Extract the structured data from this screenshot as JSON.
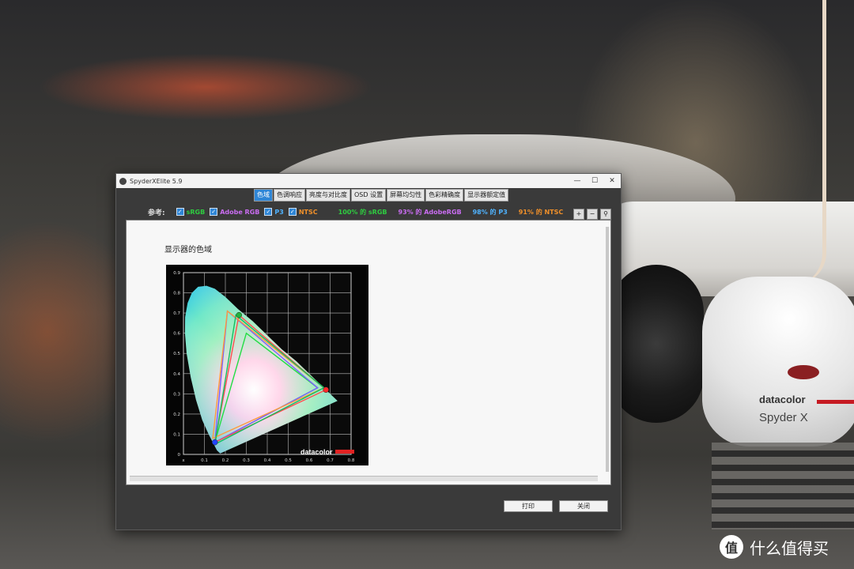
{
  "window": {
    "title": "SpyderXElite 5.9"
  },
  "tabs": [
    "色域",
    "色调响应",
    "亮度与对比度",
    "OSD 设置",
    "屏幕均匀性",
    "色彩精确度",
    "显示器额定值"
  ],
  "reference": {
    "label": "参考:",
    "checkboxes": [
      "sRGB",
      "Adobe RGB",
      "P3",
      "NTSC"
    ],
    "results": [
      "100% 的 sRGB",
      "93% 的 AdobeRGB",
      "98% 的 P3",
      "91% 的 NTSC"
    ]
  },
  "content": {
    "heading": "显示器的色域"
  },
  "buttons": {
    "print": "打印",
    "close": "关闭"
  },
  "device": {
    "brand": "datacolor",
    "model": "Spyder X"
  },
  "watermark": {
    "logo": "值",
    "text": "什么值得买"
  },
  "chart_data": {
    "type": "scatter",
    "x_ticks": [
      "x",
      "0.1",
      "0.2",
      "0.3",
      "0.4",
      "0.5",
      "0.6",
      "0.7",
      "0.8"
    ],
    "y_ticks": [
      "0.9",
      "0.8",
      "0.7",
      "0.6",
      "0.5",
      "0.4",
      "0.3",
      "0.2",
      "0.1",
      "0"
    ],
    "xlim": [
      0,
      0.8
    ],
    "ylim": [
      0,
      0.9
    ],
    "watermark": "datacolor",
    "series": [
      {
        "color": "#22dd44",
        "points": [
          [
            0.64,
            0.33
          ],
          [
            0.3,
            0.6
          ],
          [
            0.15,
            0.06
          ]
        ]
      },
      {
        "color": "#7c5cff",
        "points": [
          [
            0.64,
            0.33
          ],
          [
            0.21,
            0.71
          ],
          [
            0.15,
            0.06
          ]
        ]
      },
      {
        "color": "#ff4d4d",
        "points": [
          [
            0.68,
            0.32
          ],
          [
            0.265,
            0.69
          ],
          [
            0.15,
            0.06
          ]
        ]
      },
      {
        "color": "#ff9a3c",
        "points": [
          [
            0.67,
            0.33
          ],
          [
            0.21,
            0.71
          ],
          [
            0.14,
            0.08
          ]
        ]
      },
      {
        "color": "#10c060",
        "points": [
          [
            0.67,
            0.33
          ],
          [
            0.25,
            0.69
          ],
          [
            0.15,
            0.05
          ]
        ]
      }
    ],
    "markers": [
      {
        "color": "#ff2a2a",
        "point": [
          0.68,
          0.32
        ]
      },
      {
        "color": "#22b33c",
        "point": [
          0.265,
          0.69
        ]
      },
      {
        "color": "#2244ff",
        "point": [
          0.15,
          0.06
        ]
      }
    ]
  }
}
